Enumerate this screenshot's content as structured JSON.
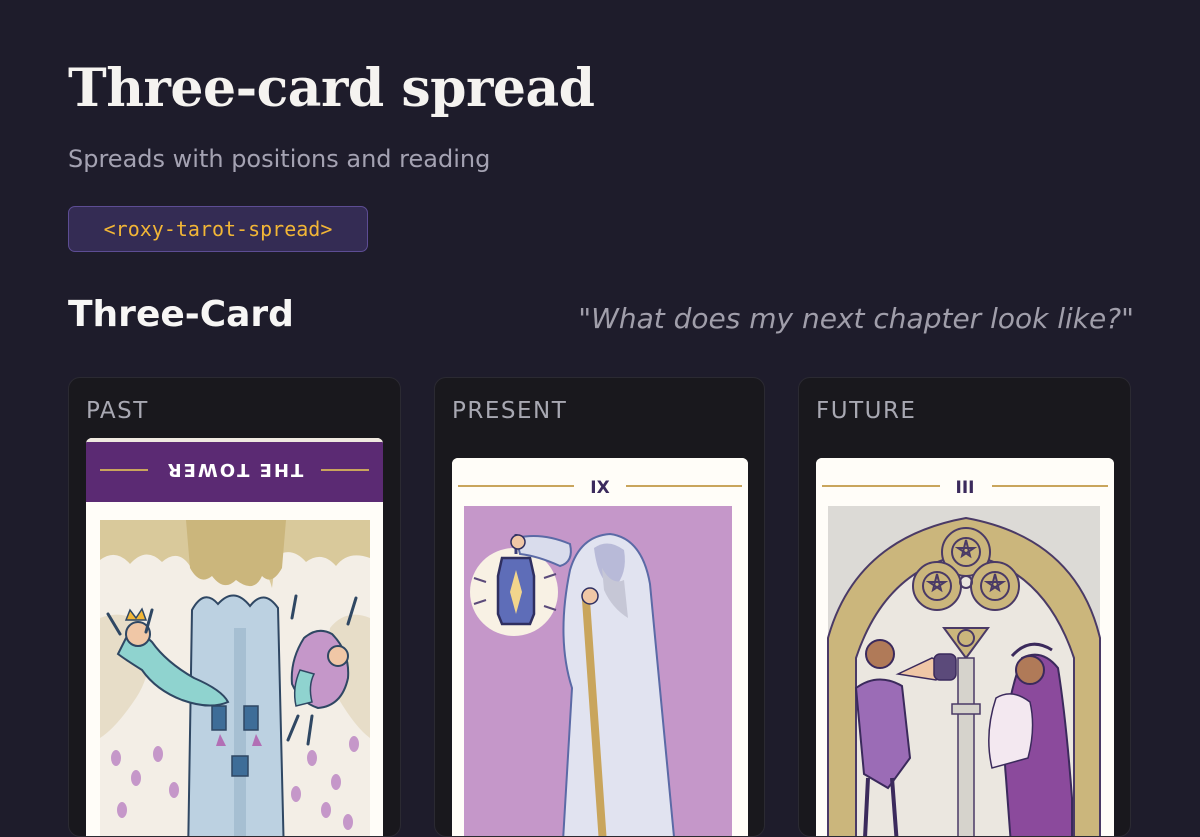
{
  "header": {
    "title": "Three-card spread",
    "subtitle": "Spreads with positions and reading",
    "component_tag": "<roxy-tarot-spread>"
  },
  "spread": {
    "name": "Three-Card",
    "question": "\"What does my next chapter look like?\"",
    "positions": [
      {
        "label": "PAST",
        "card": {
          "name": "THE TOWER",
          "reversed": true
        }
      },
      {
        "label": "PRESENT",
        "card": {
          "numeral": "IX",
          "reversed": false
        }
      },
      {
        "label": "FUTURE",
        "card": {
          "numeral": "III",
          "reversed": false
        }
      }
    ]
  },
  "colors": {
    "background": "#1e1c2b",
    "accent_tag": "#f2b636",
    "card_header_purple": "#5b2a73",
    "lilac": "#c597c9"
  }
}
